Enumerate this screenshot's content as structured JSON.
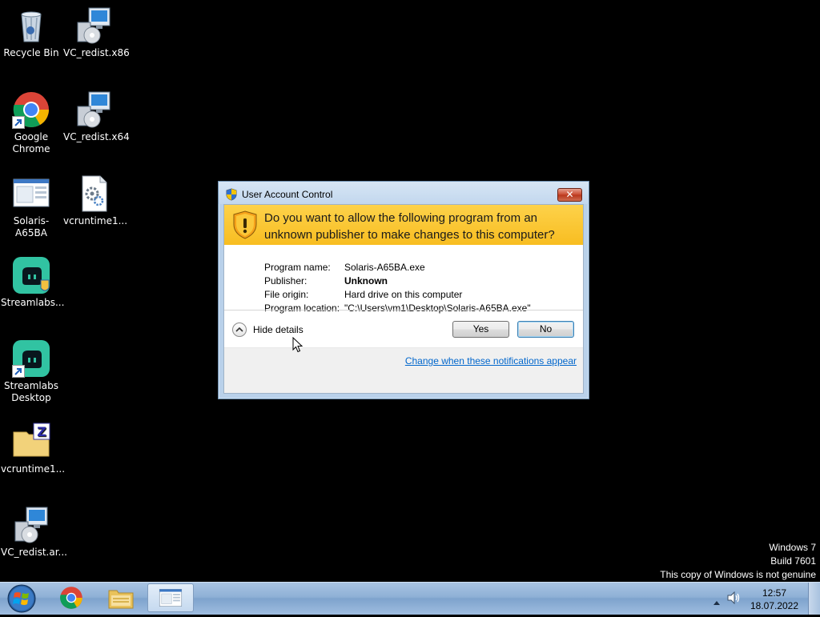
{
  "desktop": {
    "icons": [
      {
        "label": "Recycle Bin",
        "icon": "recycle-bin-icon"
      },
      {
        "label": "VC_redist.x86",
        "icon": "installer-icon"
      },
      {
        "label": "Google Chrome",
        "icon": "chrome-icon"
      },
      {
        "label": "VC_redist.x64",
        "icon": "installer-icon"
      },
      {
        "label": "Solaris-A65BA",
        "icon": "exe-icon"
      },
      {
        "label": "vcruntime1...",
        "icon": "dll-settings-icon"
      },
      {
        "label": "Streamlabs...",
        "icon": "streamlabs-icon"
      },
      {
        "label": "Streamlabs Desktop",
        "icon": "streamlabs-icon"
      },
      {
        "label": "vcruntime1...",
        "icon": "zip-folder-icon"
      },
      {
        "label": "VC_redist.ar...",
        "icon": "installer-icon"
      }
    ]
  },
  "dialog": {
    "title": "User Account Control",
    "close_label": "✕",
    "question": "Do you want to allow the following program from an unknown publisher to make changes to this computer?",
    "details": [
      {
        "key": "Program name:",
        "value": "Solaris-A65BA.exe",
        "bold": false
      },
      {
        "key": "Publisher:",
        "value": "Unknown",
        "bold": true
      },
      {
        "key": "File origin:",
        "value": "Hard drive on this computer",
        "bold": false
      },
      {
        "key": "Program location:",
        "value": "\"C:\\Users\\vm1\\Desktop\\Solaris-A65BA.exe\"",
        "bold": false
      }
    ],
    "hide_details_label": "Hide details",
    "yes_label": "Yes",
    "no_label": "No",
    "change_link": "Change when these notifications appear",
    "accent_color": "#f8bd21"
  },
  "watermark": {
    "line1": "Windows 7",
    "line2": "Build 7601",
    "line3": "This copy of Windows is not genuine"
  },
  "taskbar": {
    "items": [
      {
        "name": "start-button",
        "icon": "windows-orb-icon"
      },
      {
        "name": "chrome",
        "icon": "chrome-icon"
      },
      {
        "name": "explorer",
        "icon": "folder-icon"
      },
      {
        "name": "solaris-window",
        "icon": "exe-icon",
        "active": true
      }
    ],
    "clock": {
      "time": "12:57",
      "date": "18.07.2022"
    }
  }
}
